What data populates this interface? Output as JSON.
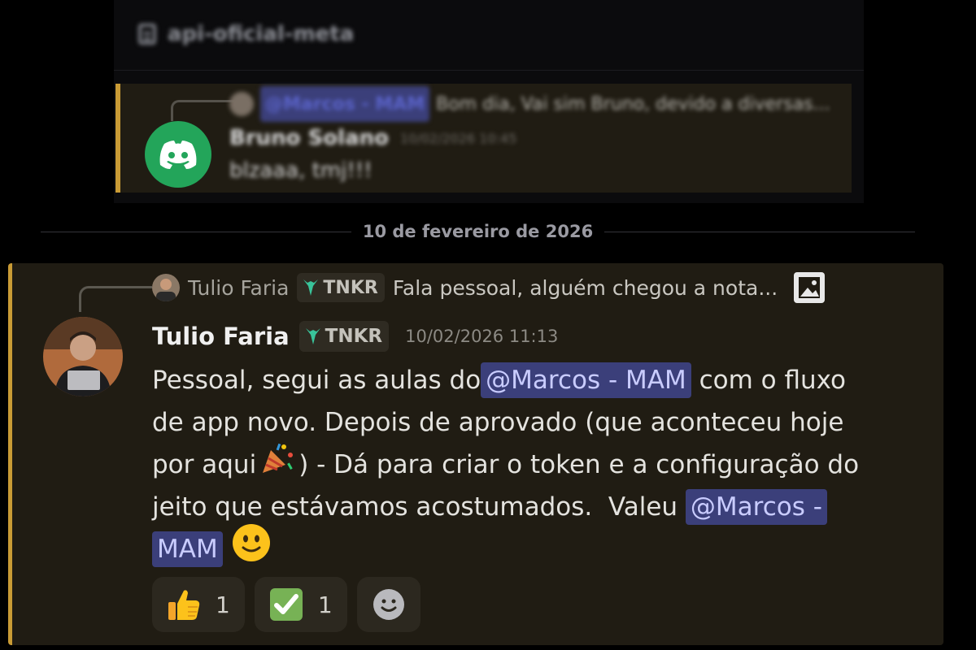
{
  "colors": {
    "background": "#000000",
    "message_bg": "#201c13",
    "highlight_bar": "#c99b35",
    "mention_bg": "#3b3f7a",
    "mention_text": "#c9ccff",
    "discord_green": "#23a55a"
  },
  "thread": {
    "name": "api-oficial-meta",
    "icon": "thread-icon"
  },
  "previous_message": {
    "reply": {
      "mention": "@Marcos - MAM",
      "text": "Bom dia, Vai sim Bruno, devido a diversas..."
    },
    "author": "Bruno Solano",
    "timestamp": "10/02/2026 10:45",
    "text": "blzaaa, tmj!!!",
    "avatar_icon": "discord-logo-icon"
  },
  "date_divider": "10 de fevereiro de 2026",
  "message": {
    "reply": {
      "author": "Tulio Faria",
      "tag": "TNKR",
      "text": "Fala pessoal, alguém chegou a nota...",
      "attachment_icon": "image-icon"
    },
    "author": "Tulio Faria",
    "tag": "TNKR",
    "timestamp": "10/02/2026 11:13",
    "lines": {
      "l1_a": "Pessoal, segui as aulas do ",
      "l1_mention": "@Marcos - MAM",
      "l1_b": " com o fluxo",
      "l2": "de app novo. Depois de aprovado (que aconteceu hoje",
      "l3_a": "por aqui",
      "l3_b": ") - Dá para criar o token e a configuração do",
      "l4_a": "jeito que estávamos acostumados.  Valeu ",
      "l4_mention": "@Marcos -",
      "l5_mention": "MAM"
    },
    "reactions": [
      {
        "emoji": "thumbs-up",
        "count": "1"
      },
      {
        "emoji": "check-mark",
        "count": "1"
      }
    ]
  }
}
